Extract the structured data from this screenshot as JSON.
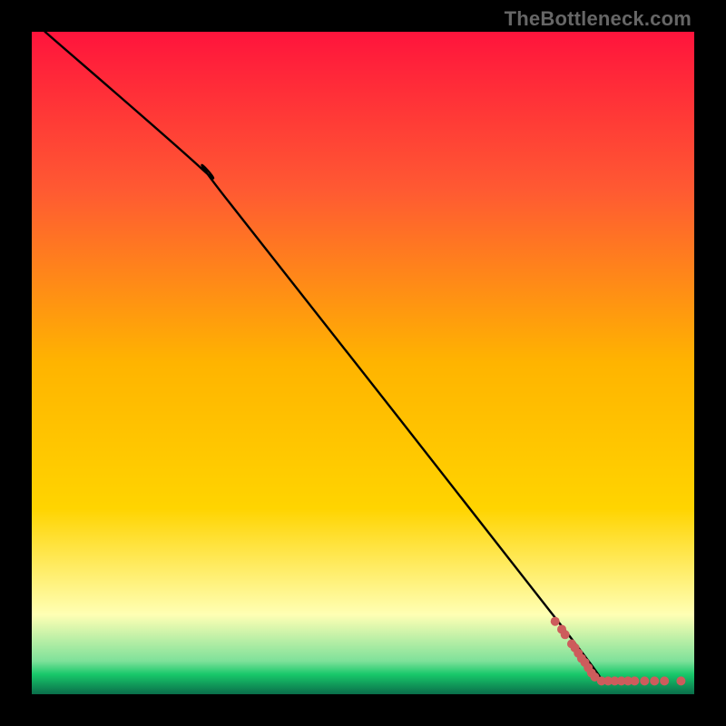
{
  "watermark": {
    "text": "TheBottleneck.com"
  },
  "chart_data": {
    "type": "line",
    "title": "",
    "xlabel": "",
    "ylabel": "",
    "xlim": [
      0,
      100
    ],
    "ylim": [
      0,
      100
    ],
    "background_gradient": {
      "top": "#ff143c",
      "mid": "#ffd400",
      "green": "#18c86a",
      "bottom": "#0a6e4a"
    },
    "series": [
      {
        "name": "curve",
        "stroke": "#000000",
        "points": [
          {
            "x": 2,
            "y": 100
          },
          {
            "x": 26,
            "y": 79
          },
          {
            "x": 30,
            "y": 74
          },
          {
            "x": 81,
            "y": 9
          },
          {
            "x": 84,
            "y": 4
          },
          {
            "x": 86,
            "y": 2
          }
        ]
      }
    ],
    "scatter": {
      "name": "points",
      "fill": "#cd5c5c",
      "radius": 5,
      "points": [
        {
          "x": 79,
          "y": 11.0
        },
        {
          "x": 80,
          "y": 9.8
        },
        {
          "x": 80.5,
          "y": 9.0
        },
        {
          "x": 81.5,
          "y": 7.6
        },
        {
          "x": 82,
          "y": 7.0
        },
        {
          "x": 82.5,
          "y": 6.2
        },
        {
          "x": 83,
          "y": 5.4
        },
        {
          "x": 83.5,
          "y": 4.8
        },
        {
          "x": 84,
          "y": 4.0
        },
        {
          "x": 84.5,
          "y": 3.2
        },
        {
          "x": 85,
          "y": 2.6
        },
        {
          "x": 86,
          "y": 2.0
        },
        {
          "x": 87,
          "y": 2.0
        },
        {
          "x": 88,
          "y": 2.0
        },
        {
          "x": 89,
          "y": 2.0
        },
        {
          "x": 90,
          "y": 2.0
        },
        {
          "x": 91,
          "y": 2.0
        },
        {
          "x": 92.5,
          "y": 2.0
        },
        {
          "x": 94,
          "y": 2.0
        },
        {
          "x": 95.5,
          "y": 2.0
        },
        {
          "x": 98,
          "y": 2.0
        }
      ]
    }
  }
}
